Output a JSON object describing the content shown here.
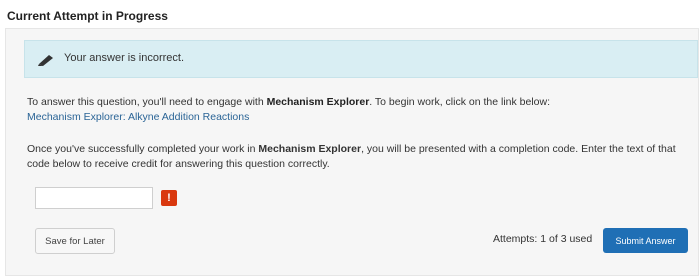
{
  "header": {
    "title": "Current Attempt in Progress"
  },
  "alert": {
    "icon": "pencil-icon",
    "text": "Your answer is incorrect."
  },
  "instructions": {
    "p1_before": "To answer this question, you'll need to engage with ",
    "p1_bold": "Mechanism Explorer",
    "p1_after": ". To begin work, click on the link below:",
    "link_text": "Mechanism Explorer: Alkyne Addition Reactions",
    "p2_before": "Once you've successfully completed your work in ",
    "p2_bold": "Mechanism Explorer",
    "p2_after": ", you will be presented with a completion code. Enter the text of that code below to receive credit for answering this question correctly."
  },
  "answer": {
    "value": "",
    "placeholder": "",
    "warning_icon": "exclamation-icon",
    "warning_glyph": "!"
  },
  "footer": {
    "save_label": "Save for Later",
    "attempts_text": "Attempts: 1 of 3 used",
    "submit_label": "Submit Answer"
  },
  "colors": {
    "alert_bg": "#d9eef3",
    "link": "#2a6496",
    "submit_bg": "#1f6fb5",
    "warning": "#d9380f"
  }
}
